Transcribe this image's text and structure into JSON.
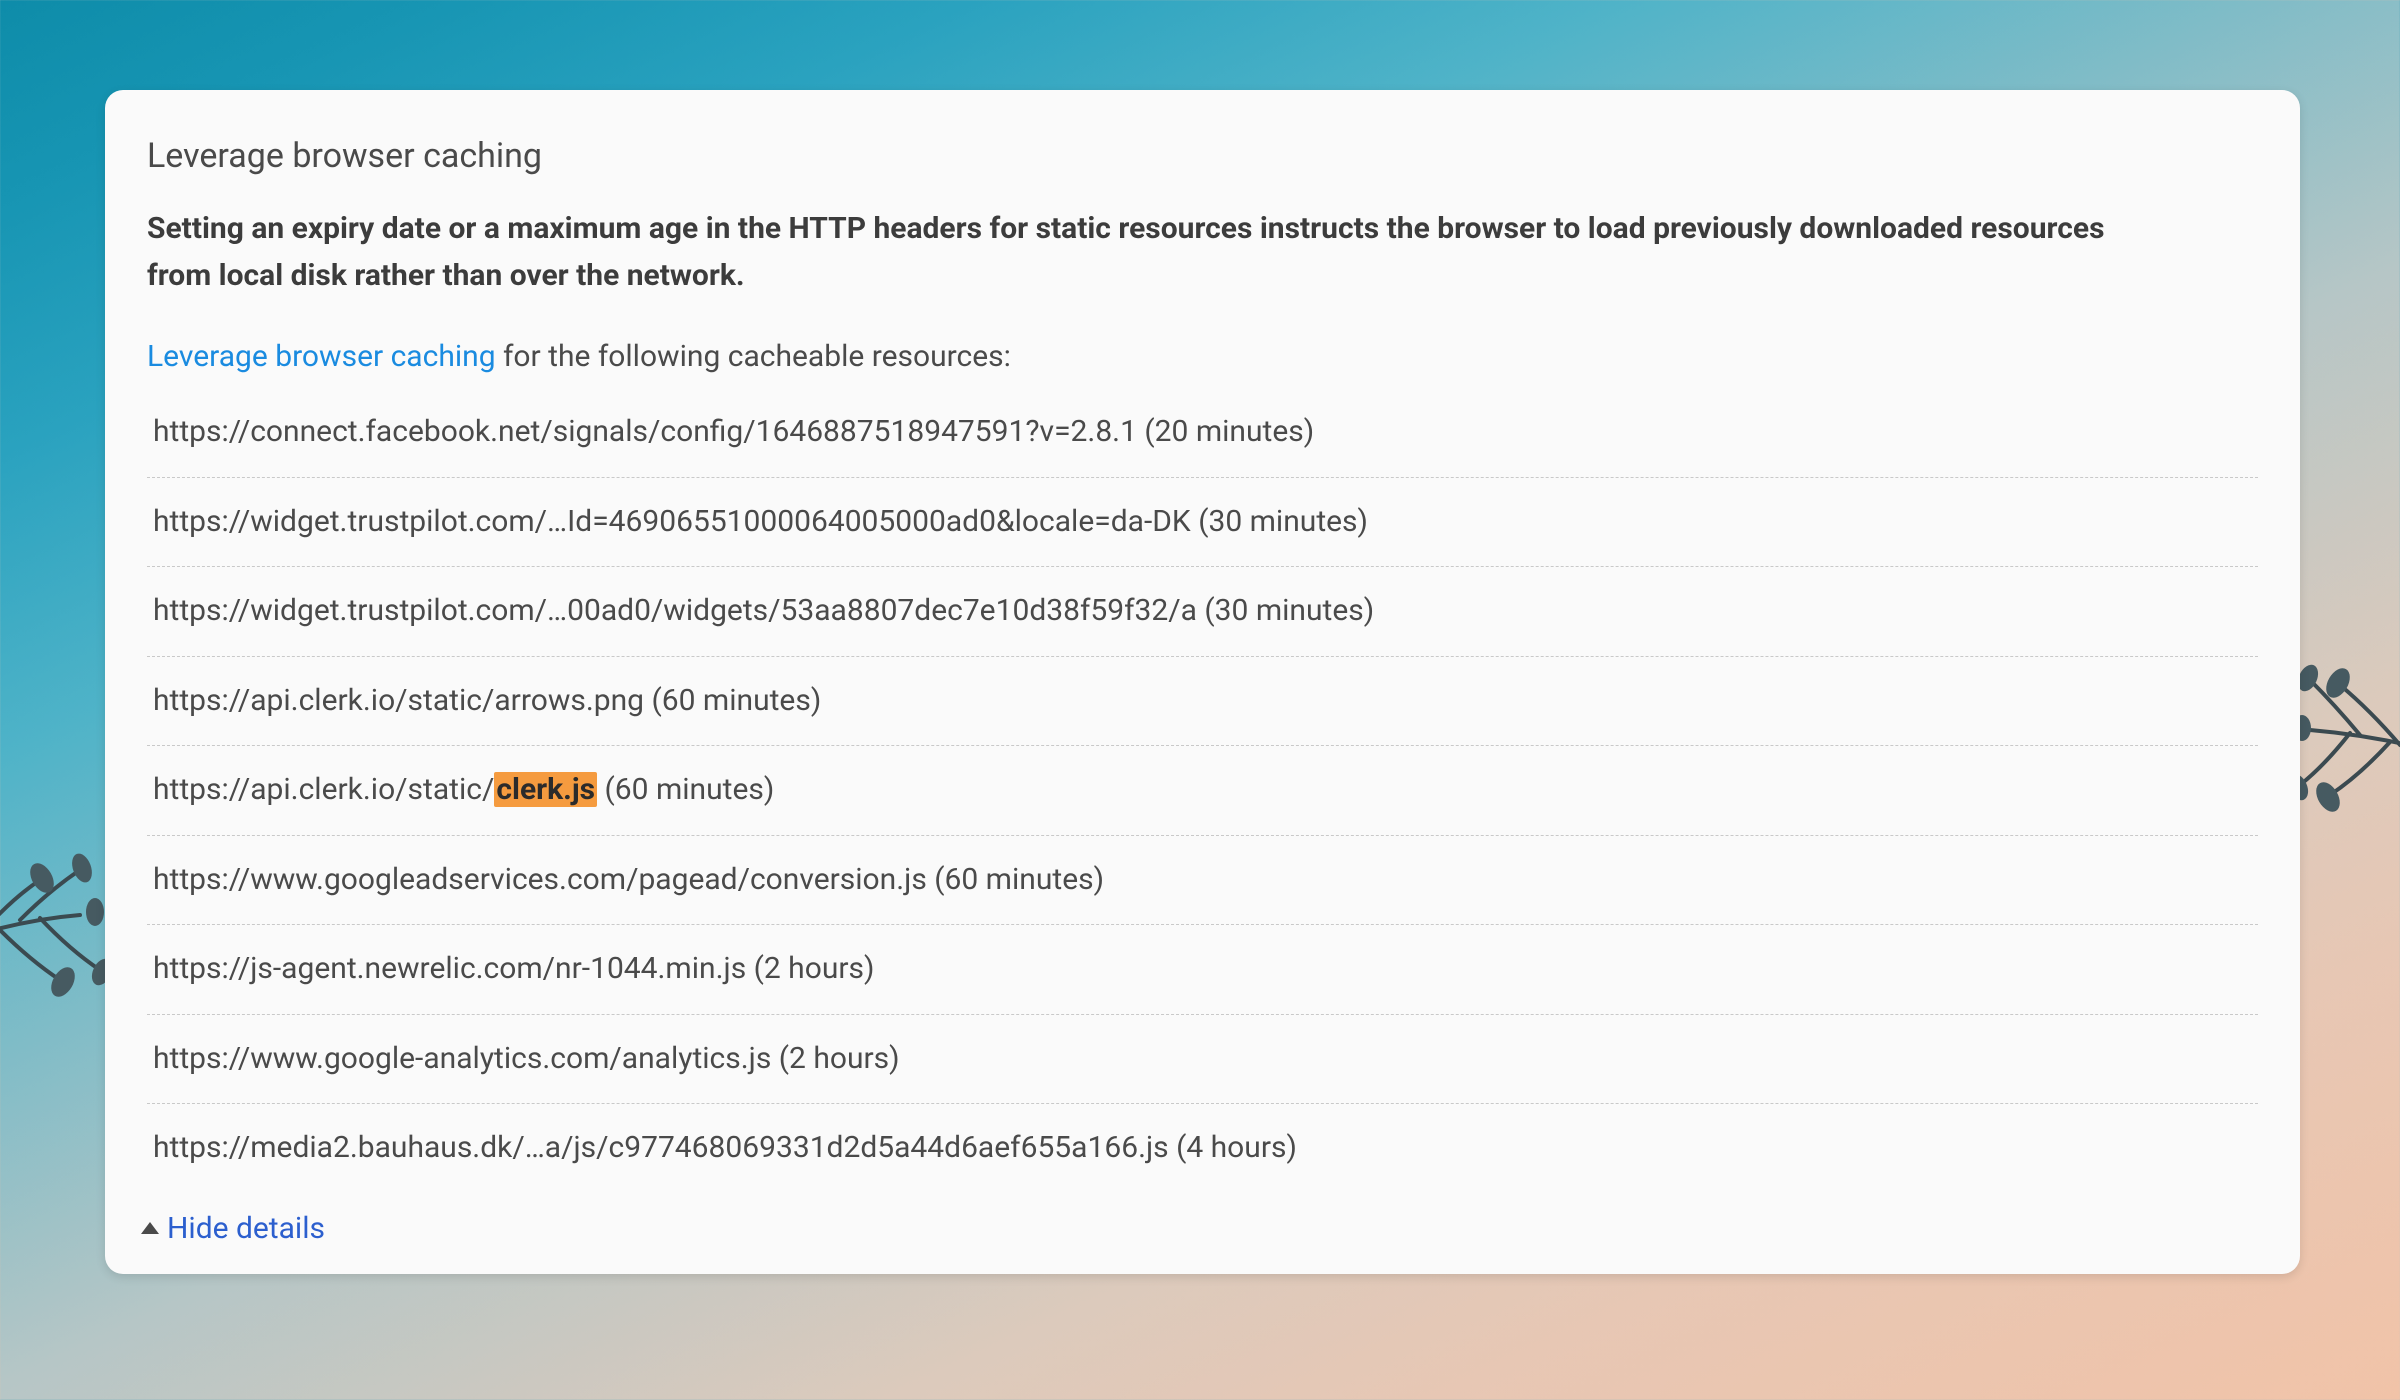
{
  "card": {
    "title": "Leverage browser caching",
    "description": "Setting an expiry date or a maximum age in the HTTP headers for static resources instructs the browser to load previously downloaded resources from local disk rather than over the network.",
    "intro_link": "Leverage browser caching",
    "intro_tail": " for the following cacheable resources:",
    "hide_details": "Hide details",
    "resources": [
      {
        "prefix": "https://connect.facebook.net/signals/config/1646887518947591?v=2.8.1 (20 minutes)",
        "highlight": "",
        "suffix": ""
      },
      {
        "prefix": "https://widget.trustpilot.com/…Id=46906551000064005000ad0&locale=da-DK (30 minutes)",
        "highlight": "",
        "suffix": ""
      },
      {
        "prefix": "https://widget.trustpilot.com/…00ad0/widgets/53aa8807dec7e10d38f59f32/a (30 minutes)",
        "highlight": "",
        "suffix": ""
      },
      {
        "prefix": "https://api.clerk.io/static/arrows.png (60 minutes)",
        "highlight": "",
        "suffix": ""
      },
      {
        "prefix": "https://api.clerk.io/static/",
        "highlight": "clerk.js",
        "suffix": " (60 minutes)"
      },
      {
        "prefix": "https://www.googleadservices.com/pagead/conversion.js (60 minutes)",
        "highlight": "",
        "suffix": ""
      },
      {
        "prefix": "https://js-agent.newrelic.com/nr-1044.min.js (2 hours)",
        "highlight": "",
        "suffix": ""
      },
      {
        "prefix": "https://www.google-analytics.com/analytics.js (2 hours)",
        "highlight": "",
        "suffix": ""
      },
      {
        "prefix": "https://media2.bauhaus.dk/…a/js/c977468069331d2d5a44d6aef655a166.js (4 hours)",
        "highlight": "",
        "suffix": ""
      }
    ]
  }
}
